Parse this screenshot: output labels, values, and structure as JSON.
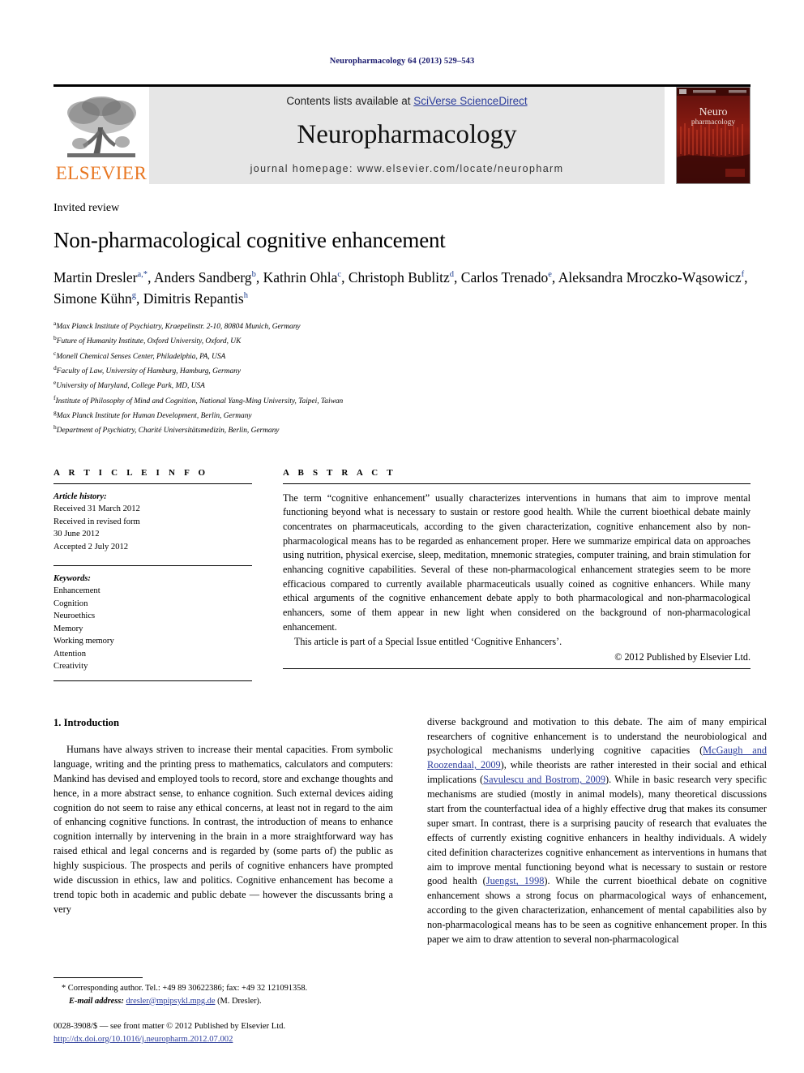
{
  "running_head": "Neuropharmacology 64 (2013) 529–543",
  "masthead": {
    "publisher_name": "ELSEVIER",
    "contents_prefix": "Contents lists available at ",
    "contents_link": "SciVerse ScienceDirect",
    "journal_title": "Neuropharmacology",
    "homepage_line": "journal homepage: www.elsevier.com/locate/neuropharm",
    "cover_title_line1": "Neuro",
    "cover_title_line2": "pharmacology"
  },
  "article": {
    "type_label": "Invited review",
    "title": "Non-pharmacological cognitive enhancement",
    "authors_line1": "Martin Dresler",
    "authors_line1_sup": "a,*",
    "authors": [
      {
        "name": "Martin Dresler",
        "sup": "a,*"
      },
      {
        "name": "Anders Sandberg",
        "sup": "b"
      },
      {
        "name": "Kathrin Ohla",
        "sup": "c"
      },
      {
        "name": "Christoph Bublitz",
        "sup": "d"
      },
      {
        "name": "Carlos Trenado",
        "sup": "e"
      },
      {
        "name": "Aleksandra Mroczko-Wąsowicz",
        "sup": "f"
      },
      {
        "name": "Simone Kühn",
        "sup": "g"
      },
      {
        "name": "Dimitris Repantis",
        "sup": "h"
      }
    ],
    "affiliations": [
      {
        "sup": "a",
        "text": "Max Planck Institute of Psychiatry, Kraepelinstr. 2-10, 80804 Munich, Germany"
      },
      {
        "sup": "b",
        "text": "Future of Humanity Institute, Oxford University, Oxford, UK"
      },
      {
        "sup": "c",
        "text": "Monell Chemical Senses Center, Philadelphia, PA, USA"
      },
      {
        "sup": "d",
        "text": "Faculty of Law, University of Hamburg, Hamburg, Germany"
      },
      {
        "sup": "e",
        "text": "University of Maryland, College Park, MD, USA"
      },
      {
        "sup": "f",
        "text": "Institute of Philosophy of Mind and Cognition, National Yang-Ming University, Taipei, Taiwan"
      },
      {
        "sup": "g",
        "text": "Max Planck Institute for Human Development, Berlin, Germany"
      },
      {
        "sup": "h",
        "text": "Department of Psychiatry, Charité Universitätsmedizin, Berlin, Germany"
      }
    ]
  },
  "article_info": {
    "heading": "A R T I C L E   I N F O",
    "history_label": "Article history:",
    "history": [
      "Received 31 March 2012",
      "Received in revised form",
      "30 June 2012",
      "Accepted 2 July 2012"
    ],
    "keywords_label": "Keywords:",
    "keywords": [
      "Enhancement",
      "Cognition",
      "Neuroethics",
      "Memory",
      "Working memory",
      "Attention",
      "Creativity"
    ]
  },
  "abstract": {
    "heading": "A B S T R A C T",
    "paragraph1": "The term “cognitive enhancement” usually characterizes interventions in humans that aim to improve mental functioning beyond what is necessary to sustain or restore good health. While the current bioethical debate mainly concentrates on pharmaceuticals, according to the given characterization, cognitive enhancement also by non-pharmacological means has to be regarded as enhancement proper. Here we summarize empirical data on approaches using nutrition, physical exercise, sleep, meditation, mnemonic strategies, computer training, and brain stimulation for enhancing cognitive capabilities. Several of these non-pharmacological enhancement strategies seem to be more efficacious compared to currently available pharmaceuticals usually coined as cognitive enhancers. While many ethical arguments of the cognitive enhancement debate apply to both pharmacological and non-pharmacological enhancers, some of them appear in new light when considered on the background of non-pharmacological enhancement.",
    "paragraph2": "This article is part of a Special Issue entitled ‘Cognitive Enhancers’.",
    "copyright": "© 2012 Published by Elsevier Ltd."
  },
  "body": {
    "section_number_title": "1. Introduction",
    "left_paragraph": "Humans have always striven to increase their mental capacities. From symbolic language, writing and the printing press to mathematics, calculators and computers: Mankind has devised and employed tools to record, store and exchange thoughts and hence, in a more abstract sense, to enhance cognition. Such external devices aiding cognition do not seem to raise any ethical concerns, at least not in regard to the aim of enhancing cognitive functions. In contrast, the introduction of means to enhance cognition internally by intervening in the brain in a more straightforward way has raised ethical and legal concerns and is regarded by (some parts of) the public as highly suspicious. The prospects and perils of cognitive enhancers have prompted wide discussion in ethics, law and politics. Cognitive enhancement has become a trend topic both in academic and public debate — however the discussants bring a very",
    "right_segments": [
      {
        "t": "diverse background and motivation to this debate. The aim of many empirical researchers of cognitive enhancement is to understand the neurobiological and psychological mechanisms underlying cognitive capacities (",
        "c": false
      },
      {
        "t": "McGaugh and Roozendaal, 2009",
        "c": true
      },
      {
        "t": "), while theorists are rather interested in their social and ethical implications (",
        "c": false
      },
      {
        "t": "Savulescu and Bostrom, 2009",
        "c": true
      },
      {
        "t": "). While in basic research very specific mechanisms are studied (mostly in animal models), many theoretical discussions start from the counterfactual idea of a highly effective drug that makes its consumer super smart. In contrast, there is a surprising paucity of research that evaluates the effects of currently existing cognitive enhancers in healthy individuals. A widely cited definition characterizes cognitive enhancement as interventions in humans that aim to improve mental functioning beyond what is necessary to sustain or restore good health (",
        "c": false
      },
      {
        "t": "Juengst, 1998",
        "c": true
      },
      {
        "t": "). While the current bioethical debate on cognitive enhancement shows a strong focus on pharmacological ways of enhancement, according to the given characterization, enhancement of mental capabilities also by non-pharmacological means has to be seen as cognitive enhancement proper. In this paper we aim to draw attention to several non-pharmacological",
        "c": false
      }
    ]
  },
  "footnotes": {
    "corresponding": "* Corresponding author. Tel.: +49 89 30622386; fax: +49 32 121091358.",
    "email_label": "E-mail address:",
    "email": "dresler@mpipsykl.mpg.de",
    "email_suffix": "(M. Dresler).",
    "issn_line": "0028-3908/$ — see front matter © 2012 Published by Elsevier Ltd.",
    "doi_line": "http://dx.doi.org/10.1016/j.neuropharm.2012.07.002"
  },
  "colors": {
    "elsevier_orange": "#E87722",
    "link_blue": "#2b3c9b",
    "cover_red": "#6d1410",
    "masthead_grey": "#e6e6e6"
  }
}
